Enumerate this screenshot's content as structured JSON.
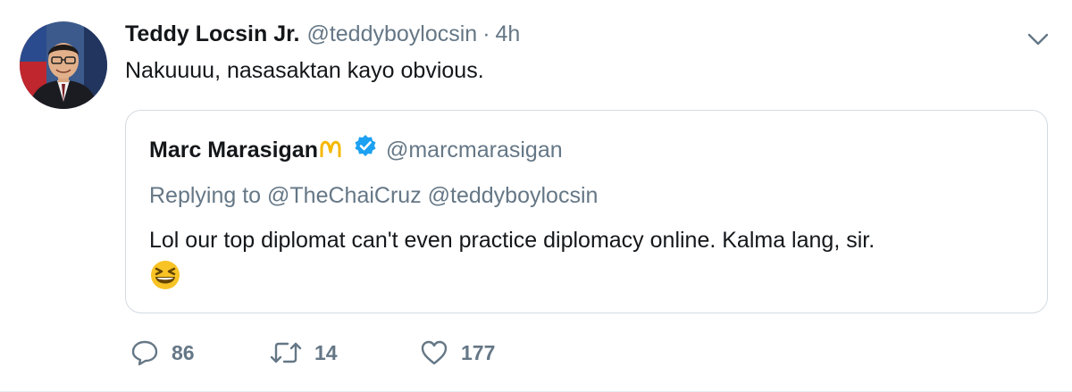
{
  "author": {
    "name": "Teddy Locsin Jr.",
    "handle": "@teddyboylocsin",
    "separator": "·",
    "time": "4h",
    "avatar_icon": "profile-photo"
  },
  "tweet": {
    "text": "Nakuuuu, nasasaktan kayo obvious."
  },
  "menu": {
    "caret_icon": "chevron-down-icon"
  },
  "quoted_tweet": {
    "name": "Marc Marasigan",
    "name_emoji": "arches-logo",
    "verified": true,
    "handle": "@marcmarasigan",
    "replying_prefix": "Replying to",
    "replying_to": [
      "@TheChaiCruz",
      "@teddyboylocsin"
    ],
    "text": "Lol our top diplomat can't even practice diplomacy online. Kalma lang, sir.",
    "emoji": "grinning-squinting-face"
  },
  "actions": {
    "replies": "86",
    "retweets": "14",
    "likes": "177"
  },
  "colors": {
    "text": "#14171a",
    "secondary": "#657786",
    "border": "#d3dbe1",
    "verified": "#1da1f2",
    "arches": "#f5b800",
    "emoji_face": "#f7c325"
  }
}
